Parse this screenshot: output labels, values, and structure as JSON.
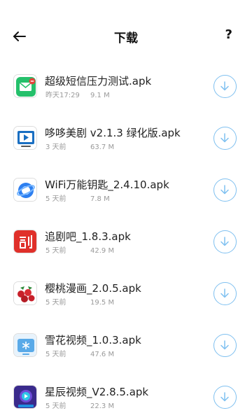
{
  "header": {
    "title": "下载",
    "help_label": "?"
  },
  "colors": {
    "accent": "#7fc0f0",
    "text_primary": "#222222",
    "text_secondary": "#9a9a9a"
  },
  "downloads": [
    {
      "name": "超级短信压力测试.apk",
      "time": "昨天17:29",
      "size": "9.1 M",
      "icon": "sms-stress-test-app-icon"
    },
    {
      "name": "哆哆美剧 v2.1.3 绿化版.apk",
      "time": "3 天前",
      "size": "63.7 M",
      "icon": "duoduo-tv-app-icon"
    },
    {
      "name": "WiFi万能钥匙_2.4.10.apk",
      "time": "5 天前",
      "size": "7.8 M",
      "icon": "wifi-key-app-icon"
    },
    {
      "name": "追剧吧_1.8.3.apk",
      "time": "5 天前",
      "size": "42.9 M",
      "icon": "zhuijuba-app-icon"
    },
    {
      "name": "樱桃漫画_2.0.5.apk",
      "time": "5 天前",
      "size": "19.5 M",
      "icon": "cherry-comic-app-icon"
    },
    {
      "name": "雪花视频_1.0.3.apk",
      "time": "5 天前",
      "size": "47.6 M",
      "icon": "snowflake-video-app-icon"
    },
    {
      "name": "星辰视频_V2.8.5.apk",
      "time": "5 天前",
      "size": "22.3 M",
      "icon": "star-video-app-icon"
    }
  ]
}
